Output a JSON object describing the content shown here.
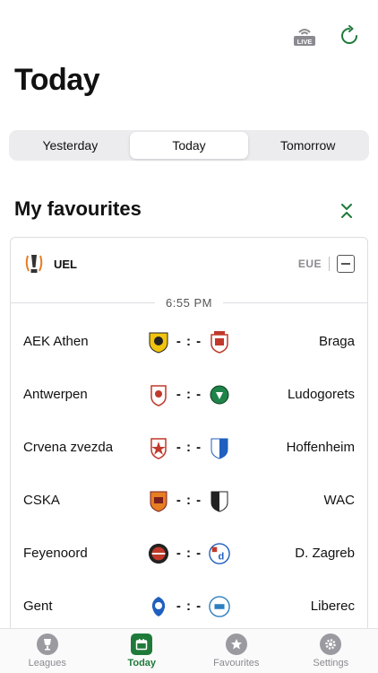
{
  "header": {
    "live_label": "LIVE",
    "title": "Today"
  },
  "segment": {
    "items": [
      "Yesterday",
      "Today",
      "Tomorrow"
    ],
    "active": 1
  },
  "favourites": {
    "title": "My favourites"
  },
  "league": {
    "name": "UEL",
    "region": "EUE"
  },
  "kickoff": "6:55 PM",
  "matches": [
    {
      "home": "AEK Athen",
      "away": "Braga",
      "score": "- : -"
    },
    {
      "home": "Antwerpen",
      "away": "Ludogorets",
      "score": "- : -"
    },
    {
      "home": "Crvena zvezda",
      "away": "Hoffenheim",
      "score": "- : -"
    },
    {
      "home": "CSKA",
      "away": "WAC",
      "score": "- : -"
    },
    {
      "home": "Feyenoord",
      "away": "D. Zagreb",
      "score": "- : -"
    },
    {
      "home": "Gent",
      "away": "Liberec",
      "score": "- : -"
    }
  ],
  "tabs": [
    {
      "label": "Leagues",
      "icon": "trophy-icon"
    },
    {
      "label": "Today",
      "icon": "calendar-icon"
    },
    {
      "label": "Favourites",
      "icon": "star-icon"
    },
    {
      "label": "Settings",
      "icon": "gear-icon"
    }
  ],
  "colors": {
    "accent": "#1f7a3a",
    "inactive": "#8a8a90"
  }
}
